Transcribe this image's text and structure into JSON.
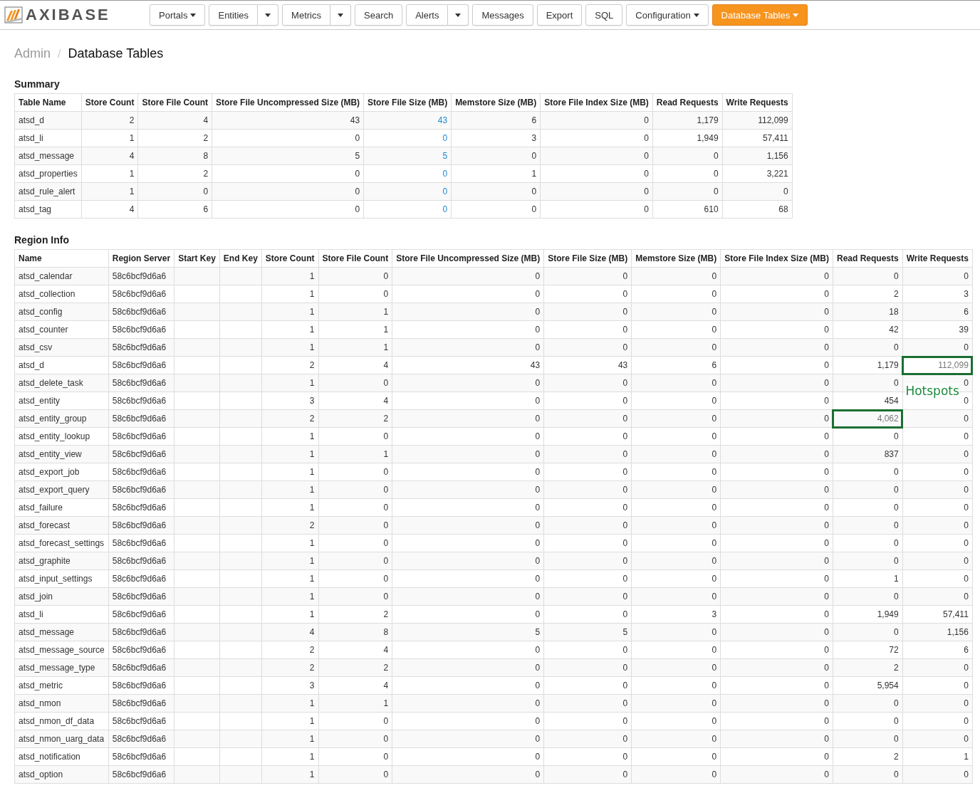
{
  "brand": "AXIBASE",
  "nav": [
    {
      "label": "Portals",
      "kind": "dropdown",
      "selected": false
    },
    {
      "label": "Entities",
      "kind": "split",
      "selected": false
    },
    {
      "label": "Metrics",
      "kind": "split",
      "selected": false
    },
    {
      "label": "Search",
      "kind": "plain",
      "selected": false
    },
    {
      "label": "Alerts",
      "kind": "split",
      "selected": false
    },
    {
      "label": "Messages",
      "kind": "plain",
      "selected": false
    },
    {
      "label": "Export",
      "kind": "plain",
      "selected": false
    },
    {
      "label": "SQL",
      "kind": "plain",
      "selected": false
    },
    {
      "label": "Configuration",
      "kind": "dropdown",
      "selected": false
    },
    {
      "label": "Database Tables",
      "kind": "dropdown",
      "selected": true
    }
  ],
  "breadcrumb": {
    "parent": "Admin",
    "separator": "/",
    "current": "Database Tables"
  },
  "summary": {
    "title": "Summary",
    "columns": [
      "Table Name",
      "Store Count",
      "Store File Count",
      "Store File Uncompressed Size (MB)",
      "Store File Size (MB)",
      "Memstore Size (MB)",
      "Store File Index Size (MB)",
      "Read Requests",
      "Write Requests"
    ],
    "rows": [
      {
        "name": "atsd_d",
        "values": [
          "2",
          "4",
          "43",
          "43",
          "6",
          "0",
          "1,179",
          "112,099"
        ]
      },
      {
        "name": "atsd_li",
        "values": [
          "1",
          "2",
          "0",
          "0",
          "3",
          "0",
          "1,949",
          "57,411"
        ]
      },
      {
        "name": "atsd_message",
        "values": [
          "4",
          "8",
          "5",
          "5",
          "0",
          "0",
          "0",
          "1,156"
        ]
      },
      {
        "name": "atsd_properties",
        "values": [
          "1",
          "2",
          "0",
          "0",
          "1",
          "0",
          "0",
          "3,221"
        ]
      },
      {
        "name": "atsd_rule_alert",
        "values": [
          "1",
          "0",
          "0",
          "0",
          "0",
          "0",
          "0",
          "0"
        ]
      },
      {
        "name": "atsd_tag",
        "values": [
          "4",
          "6",
          "0",
          "0",
          "0",
          "0",
          "610",
          "68"
        ]
      }
    ]
  },
  "region_info": {
    "title": "Region Info",
    "annotation": "Hotspots",
    "columns": [
      "Name",
      "Region Server",
      "Start Key",
      "End Key",
      "Store Count",
      "Store File Count",
      "Store File Uncompressed Size (MB)",
      "Store File Size (MB)",
      "Memstore Size (MB)",
      "Store File Index Size (MB)",
      "Read Requests",
      "Write Requests"
    ],
    "rows": [
      {
        "name": "atsd_calendar",
        "server": "58c6bcf9d6a6",
        "values": [
          "1",
          "0",
          "0",
          "0",
          "0",
          "0",
          "0",
          "0"
        ],
        "read_hot": false,
        "write_hot": false
      },
      {
        "name": "atsd_collection",
        "server": "58c6bcf9d6a6",
        "values": [
          "1",
          "0",
          "0",
          "0",
          "0",
          "0",
          "2",
          "3"
        ],
        "read_hot": false,
        "write_hot": false
      },
      {
        "name": "atsd_config",
        "server": "58c6bcf9d6a6",
        "values": [
          "1",
          "1",
          "0",
          "0",
          "0",
          "0",
          "18",
          "6"
        ],
        "read_hot": false,
        "write_hot": false
      },
      {
        "name": "atsd_counter",
        "server": "58c6bcf9d6a6",
        "values": [
          "1",
          "1",
          "0",
          "0",
          "0",
          "0",
          "42",
          "39"
        ],
        "read_hot": false,
        "write_hot": false
      },
      {
        "name": "atsd_csv",
        "server": "58c6bcf9d6a6",
        "values": [
          "1",
          "1",
          "0",
          "0",
          "0",
          "0",
          "0",
          "0"
        ],
        "read_hot": false,
        "write_hot": false
      },
      {
        "name": "atsd_d",
        "server": "58c6bcf9d6a6",
        "values": [
          "2",
          "4",
          "43",
          "43",
          "6",
          "0",
          "1,179",
          "112,099"
        ],
        "read_hot": false,
        "write_hot": true
      },
      {
        "name": "atsd_delete_task",
        "server": "58c6bcf9d6a6",
        "values": [
          "1",
          "0",
          "0",
          "0",
          "0",
          "0",
          "0",
          "0"
        ],
        "read_hot": false,
        "write_hot": false
      },
      {
        "name": "atsd_entity",
        "server": "58c6bcf9d6a6",
        "values": [
          "3",
          "4",
          "0",
          "0",
          "0",
          "0",
          "454",
          "0"
        ],
        "read_hot": false,
        "write_hot": false
      },
      {
        "name": "atsd_entity_group",
        "server": "58c6bcf9d6a6",
        "values": [
          "2",
          "2",
          "0",
          "0",
          "0",
          "0",
          "4,062",
          "0"
        ],
        "read_hot": true,
        "write_hot": false
      },
      {
        "name": "atsd_entity_lookup",
        "server": "58c6bcf9d6a6",
        "values": [
          "1",
          "0",
          "0",
          "0",
          "0",
          "0",
          "0",
          "0"
        ],
        "read_hot": false,
        "write_hot": false
      },
      {
        "name": "atsd_entity_view",
        "server": "58c6bcf9d6a6",
        "values": [
          "1",
          "1",
          "0",
          "0",
          "0",
          "0",
          "837",
          "0"
        ],
        "read_hot": false,
        "write_hot": false
      },
      {
        "name": "atsd_export_job",
        "server": "58c6bcf9d6a6",
        "values": [
          "1",
          "0",
          "0",
          "0",
          "0",
          "0",
          "0",
          "0"
        ],
        "read_hot": false,
        "write_hot": false
      },
      {
        "name": "atsd_export_query",
        "server": "58c6bcf9d6a6",
        "values": [
          "1",
          "0",
          "0",
          "0",
          "0",
          "0",
          "0",
          "0"
        ],
        "read_hot": false,
        "write_hot": false
      },
      {
        "name": "atsd_failure",
        "server": "58c6bcf9d6a6",
        "values": [
          "1",
          "0",
          "0",
          "0",
          "0",
          "0",
          "0",
          "0"
        ],
        "read_hot": false,
        "write_hot": false
      },
      {
        "name": "atsd_forecast",
        "server": "58c6bcf9d6a6",
        "values": [
          "2",
          "0",
          "0",
          "0",
          "0",
          "0",
          "0",
          "0"
        ],
        "read_hot": false,
        "write_hot": false
      },
      {
        "name": "atsd_forecast_settings",
        "server": "58c6bcf9d6a6",
        "values": [
          "1",
          "0",
          "0",
          "0",
          "0",
          "0",
          "0",
          "0"
        ],
        "read_hot": false,
        "write_hot": false
      },
      {
        "name": "atsd_graphite",
        "server": "58c6bcf9d6a6",
        "values": [
          "1",
          "0",
          "0",
          "0",
          "0",
          "0",
          "0",
          "0"
        ],
        "read_hot": false,
        "write_hot": false
      },
      {
        "name": "atsd_input_settings",
        "server": "58c6bcf9d6a6",
        "values": [
          "1",
          "0",
          "0",
          "0",
          "0",
          "0",
          "1",
          "0"
        ],
        "read_hot": false,
        "write_hot": false
      },
      {
        "name": "atsd_join",
        "server": "58c6bcf9d6a6",
        "values": [
          "1",
          "0",
          "0",
          "0",
          "0",
          "0",
          "0",
          "0"
        ],
        "read_hot": false,
        "write_hot": false
      },
      {
        "name": "atsd_li",
        "server": "58c6bcf9d6a6",
        "values": [
          "1",
          "2",
          "0",
          "0",
          "3",
          "0",
          "1,949",
          "57,411"
        ],
        "read_hot": false,
        "write_hot": false
      },
      {
        "name": "atsd_message",
        "server": "58c6bcf9d6a6",
        "values": [
          "4",
          "8",
          "5",
          "5",
          "0",
          "0",
          "0",
          "1,156"
        ],
        "read_hot": false,
        "write_hot": false
      },
      {
        "name": "atsd_message_source",
        "server": "58c6bcf9d6a6",
        "values": [
          "2",
          "4",
          "0",
          "0",
          "0",
          "0",
          "72",
          "6"
        ],
        "read_hot": false,
        "write_hot": false
      },
      {
        "name": "atsd_message_type",
        "server": "58c6bcf9d6a6",
        "values": [
          "2",
          "2",
          "0",
          "0",
          "0",
          "0",
          "2",
          "0"
        ],
        "read_hot": false,
        "write_hot": false
      },
      {
        "name": "atsd_metric",
        "server": "58c6bcf9d6a6",
        "values": [
          "3",
          "4",
          "0",
          "0",
          "0",
          "0",
          "5,954",
          "0"
        ],
        "read_hot": false,
        "write_hot": false
      },
      {
        "name": "atsd_nmon",
        "server": "58c6bcf9d6a6",
        "values": [
          "1",
          "1",
          "0",
          "0",
          "0",
          "0",
          "0",
          "0"
        ],
        "read_hot": false,
        "write_hot": false
      },
      {
        "name": "atsd_nmon_df_data",
        "server": "58c6bcf9d6a6",
        "values": [
          "1",
          "0",
          "0",
          "0",
          "0",
          "0",
          "0",
          "0"
        ],
        "read_hot": false,
        "write_hot": false
      },
      {
        "name": "atsd_nmon_uarg_data",
        "server": "58c6bcf9d6a6",
        "values": [
          "1",
          "0",
          "0",
          "0",
          "0",
          "0",
          "0",
          "0"
        ],
        "read_hot": false,
        "write_hot": false
      },
      {
        "name": "atsd_notification",
        "server": "58c6bcf9d6a6",
        "values": [
          "1",
          "0",
          "0",
          "0",
          "0",
          "0",
          "2",
          "1"
        ],
        "read_hot": false,
        "write_hot": false
      },
      {
        "name": "atsd_option",
        "server": "58c6bcf9d6a6",
        "values": [
          "1",
          "0",
          "0",
          "0",
          "0",
          "0",
          "0",
          "0"
        ],
        "read_hot": false,
        "write_hot": false
      }
    ]
  }
}
